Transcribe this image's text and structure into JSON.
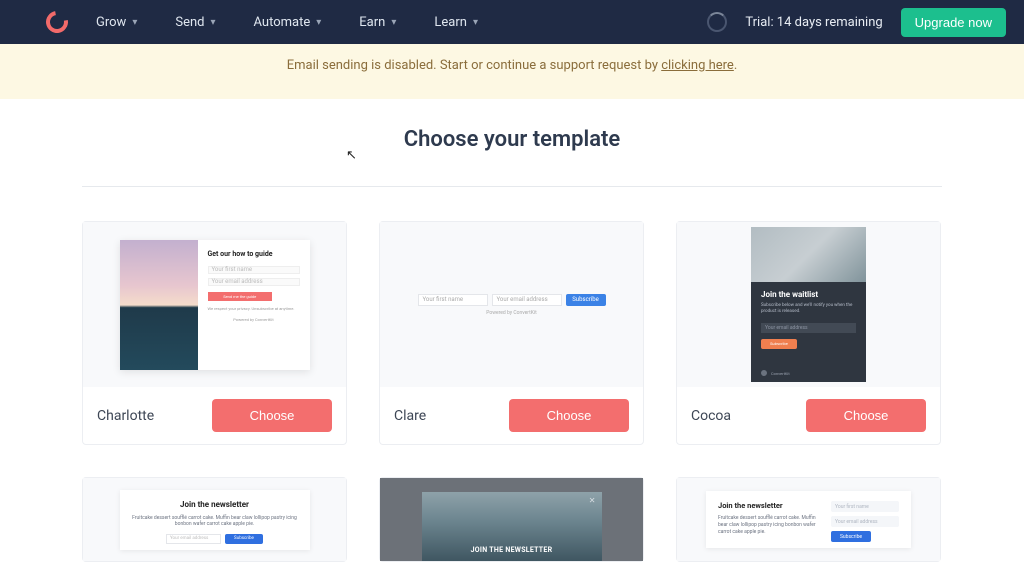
{
  "nav": {
    "items": [
      "Grow",
      "Send",
      "Automate",
      "Earn",
      "Learn"
    ],
    "trial_text": "Trial: 14 days remaining",
    "upgrade_label": "Upgrade now"
  },
  "banner": {
    "text_before": "Email sending is disabled. Start or continue a support request by ",
    "link_text": "clicking here",
    "text_after": "."
  },
  "page": {
    "title": "Choose your template"
  },
  "templates": [
    {
      "name": "Charlotte",
      "choose_label": "Choose",
      "preview": {
        "heading": "Get our how to guide",
        "field1": "Your first name",
        "field2": "Your email address",
        "button": "Send me the guide",
        "privacy": "We respect your privacy. Unsubscribe at anytime.",
        "powered": "Powered by ConvertKit"
      }
    },
    {
      "name": "Clare",
      "choose_label": "Choose",
      "preview": {
        "field1": "Your first name",
        "field2": "Your email address",
        "button": "Subscribe",
        "powered": "Powered by ConvertKit"
      }
    },
    {
      "name": "Cocoa",
      "choose_label": "Choose",
      "preview": {
        "heading": "Join the waitlist",
        "sub": "Subscribe below and we'll notify you when the product is released.",
        "field1": "Your email address",
        "button": "Subscribe",
        "powered": "ConvertKit"
      }
    },
    {
      "name": "",
      "choose_label": "",
      "preview": {
        "heading": "Join the newsletter",
        "sub": "Fruitcake dessert soufflé carrot cake. Muffin bear claw lollipop pastry icing bonbon wafer carrot cake apple pie.",
        "field1": "Your email address",
        "button": "Subscribe"
      }
    },
    {
      "name": "",
      "choose_label": "",
      "preview": {
        "heading": "JOIN THE NEWSLETTER"
      }
    },
    {
      "name": "",
      "choose_label": "",
      "preview": {
        "heading": "Join the newsletter",
        "sub": "Fruitcake dessert soufflé carrot cake. Muffin bear claw lollipop pastry icing bonbon wafer carrot cake apple pie.",
        "field1": "Your first name",
        "field2": "Your email address",
        "button": "Subscribe"
      }
    }
  ]
}
